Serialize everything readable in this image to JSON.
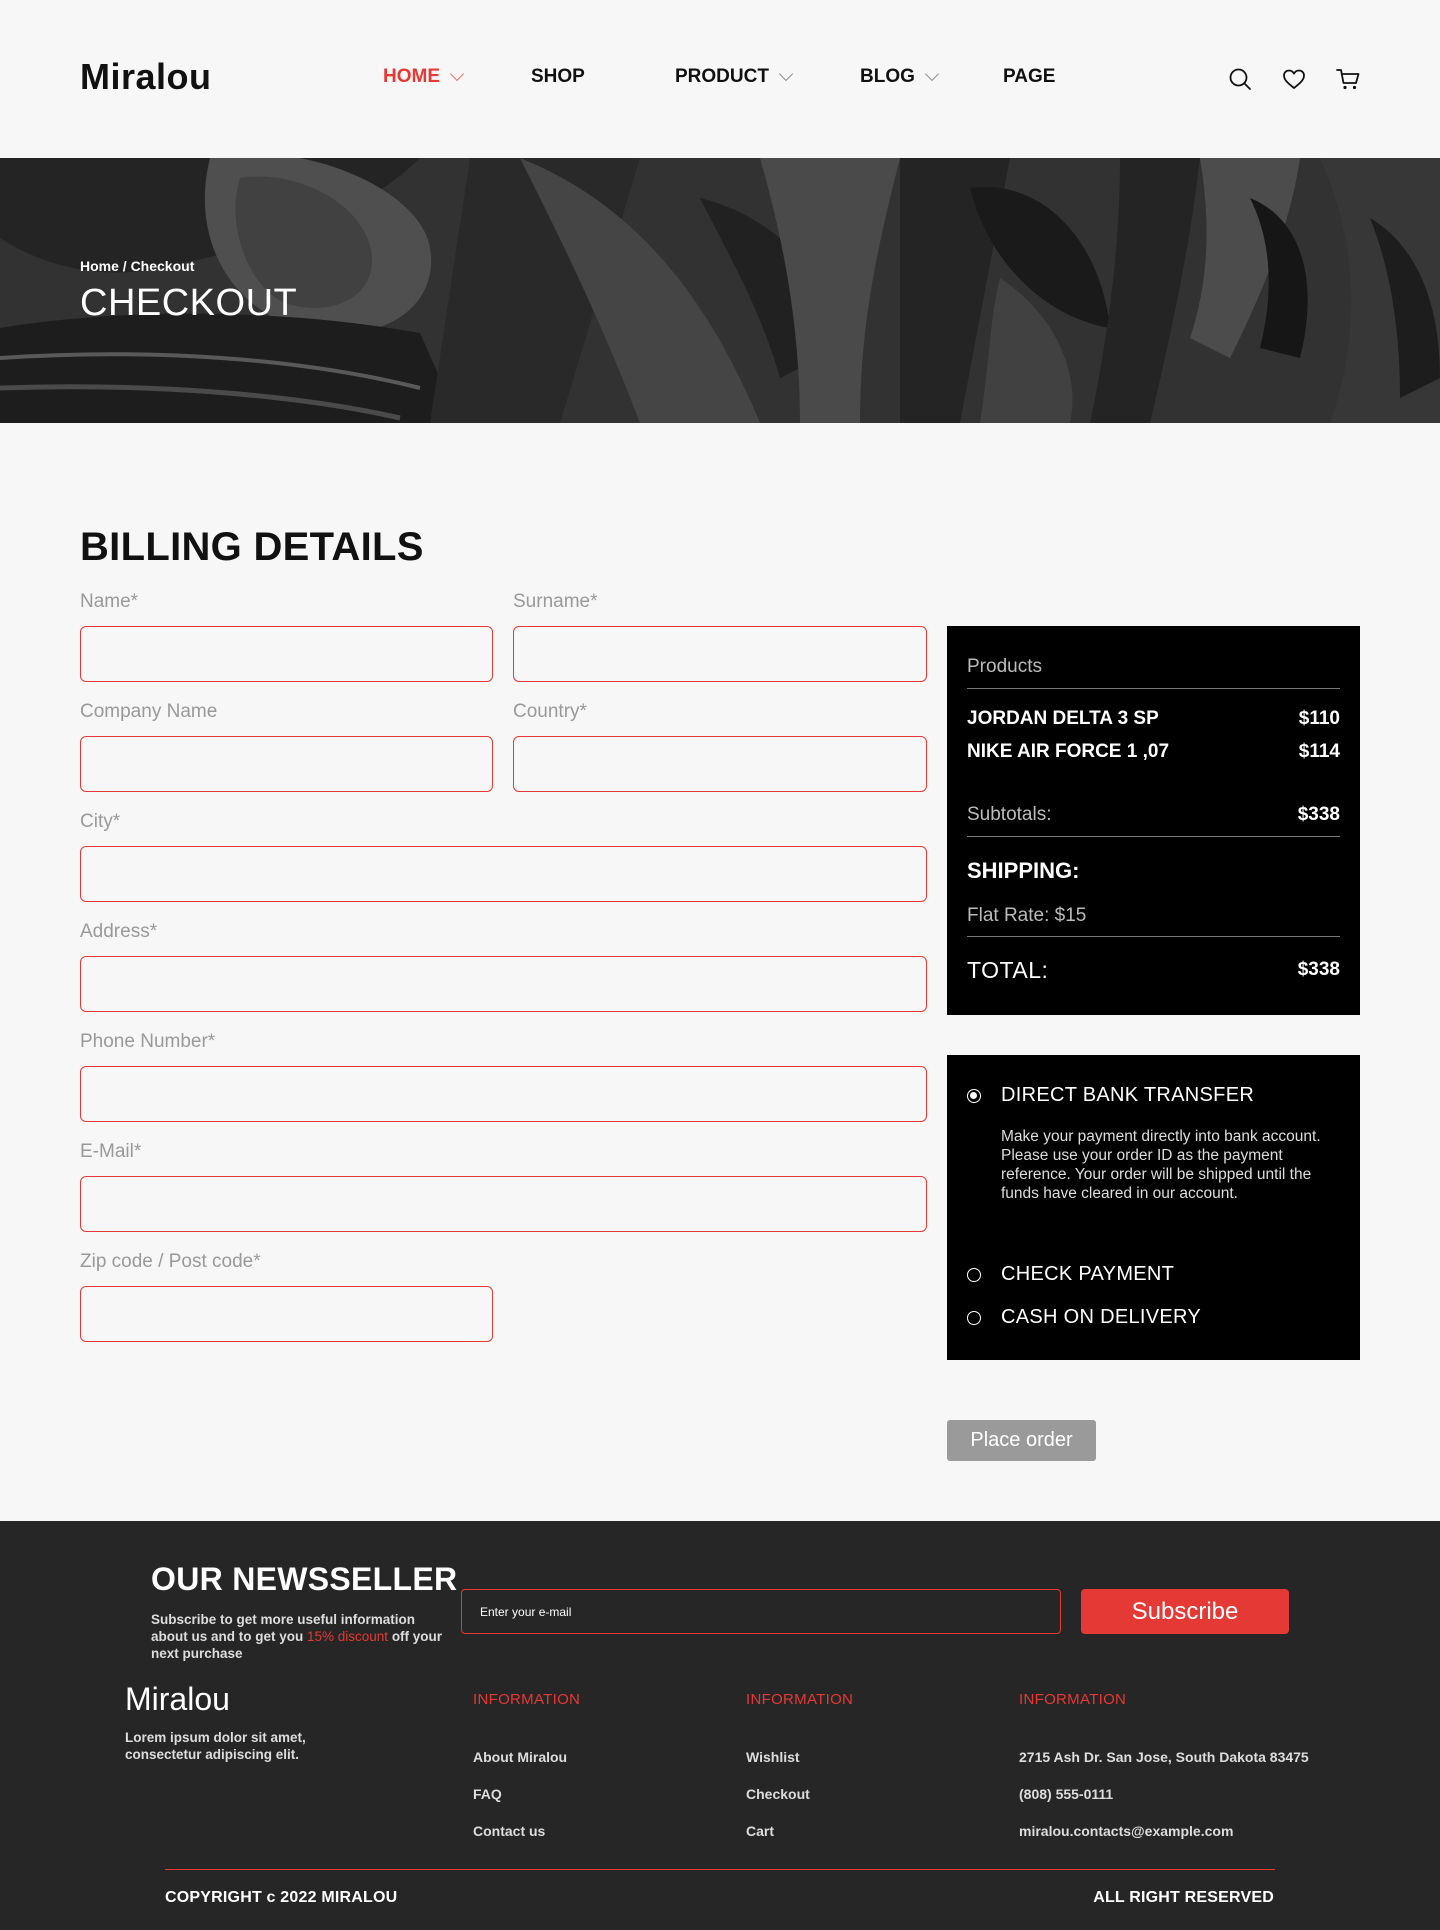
{
  "header": {
    "logo": "Miralou",
    "nav": [
      {
        "label": "HOME",
        "active": true
      },
      {
        "label": "SHOP"
      },
      {
        "label": "PRODUCT"
      },
      {
        "label": "BLOG"
      },
      {
        "label": "PAGE"
      }
    ],
    "icons": [
      "search-icon",
      "heart-icon",
      "cart-icon"
    ]
  },
  "hero": {
    "breadcrumb": "Home / Checkout",
    "title": "CHECKOUT"
  },
  "billing": {
    "title": "BILLING DETAILS",
    "fields": {
      "name": {
        "label": "Name*",
        "value": ""
      },
      "surname": {
        "label": "Surname*",
        "value": ""
      },
      "company": {
        "label": "Company Name",
        "value": ""
      },
      "country": {
        "label": "Country*",
        "value": ""
      },
      "city": {
        "label": "City*",
        "value": ""
      },
      "address": {
        "label": "Address*",
        "value": ""
      },
      "phone": {
        "label": "Phone Number*",
        "value": ""
      },
      "email": {
        "label": "E-Mail*",
        "value": ""
      },
      "zip": {
        "label": "Zip code / Post code*",
        "value": ""
      }
    }
  },
  "summary": {
    "products_label": "Products",
    "items": [
      {
        "name": "JORDAN DELTA 3 SP",
        "price": "$110"
      },
      {
        "name": "NIKE AIR FORCE 1 ,07",
        "price": "$114"
      }
    ],
    "subtotals_label": "Subtotals:",
    "subtotals_value": "$338",
    "shipping_label": "SHIPPING:",
    "shipping_rate": "Flat Rate: $15",
    "total_label": "TOTAL:",
    "total_value": "$338"
  },
  "payment": {
    "options": [
      {
        "label": "DIRECT BANK TRANSFER",
        "selected": true
      },
      {
        "label": "CHECK PAYMENT",
        "selected": false
      },
      {
        "label": "CASH ON DELIVERY",
        "selected": false
      }
    ],
    "bank_description": "Make your payment directly into bank account. Please use your order ID as the payment reference. Your order will be shipped until the funds have cleared in our account."
  },
  "place_order_label": "Place order",
  "footer": {
    "newsletter": {
      "title": "OUR NEWSSELLER",
      "sub_before": "Subscribe to get more useful information about us and to get you ",
      "sub_highlight": "15% discount",
      "sub_after": " off your next purchase",
      "placeholder": "Enter your e-mail",
      "button": "Subscribe"
    },
    "logo": "Miralou",
    "description": "Lorem ipsum dolor sit amet, consectetur adipiscing elit.",
    "columns": [
      {
        "title": "INFORMATION",
        "links": [
          "About Miralou",
          "FAQ",
          "Contact us"
        ]
      },
      {
        "title": "INFORMATION",
        "links": [
          "Wishlist",
          "Checkout",
          "Cart"
        ]
      },
      {
        "title": "INFORMATION",
        "links": [
          "2715 Ash Dr. San Jose, South Dakota 83475",
          "(808) 555-0111",
          "miralou.contacts@example.com"
        ]
      }
    ],
    "copyright": "COPYRIGHT c 2022 MIRALOU",
    "rights": "ALL RIGHT RESERVED"
  },
  "colors": {
    "accent": "#e53935",
    "dark": "#262626",
    "black": "#000000",
    "background": "#f7f7f7"
  }
}
